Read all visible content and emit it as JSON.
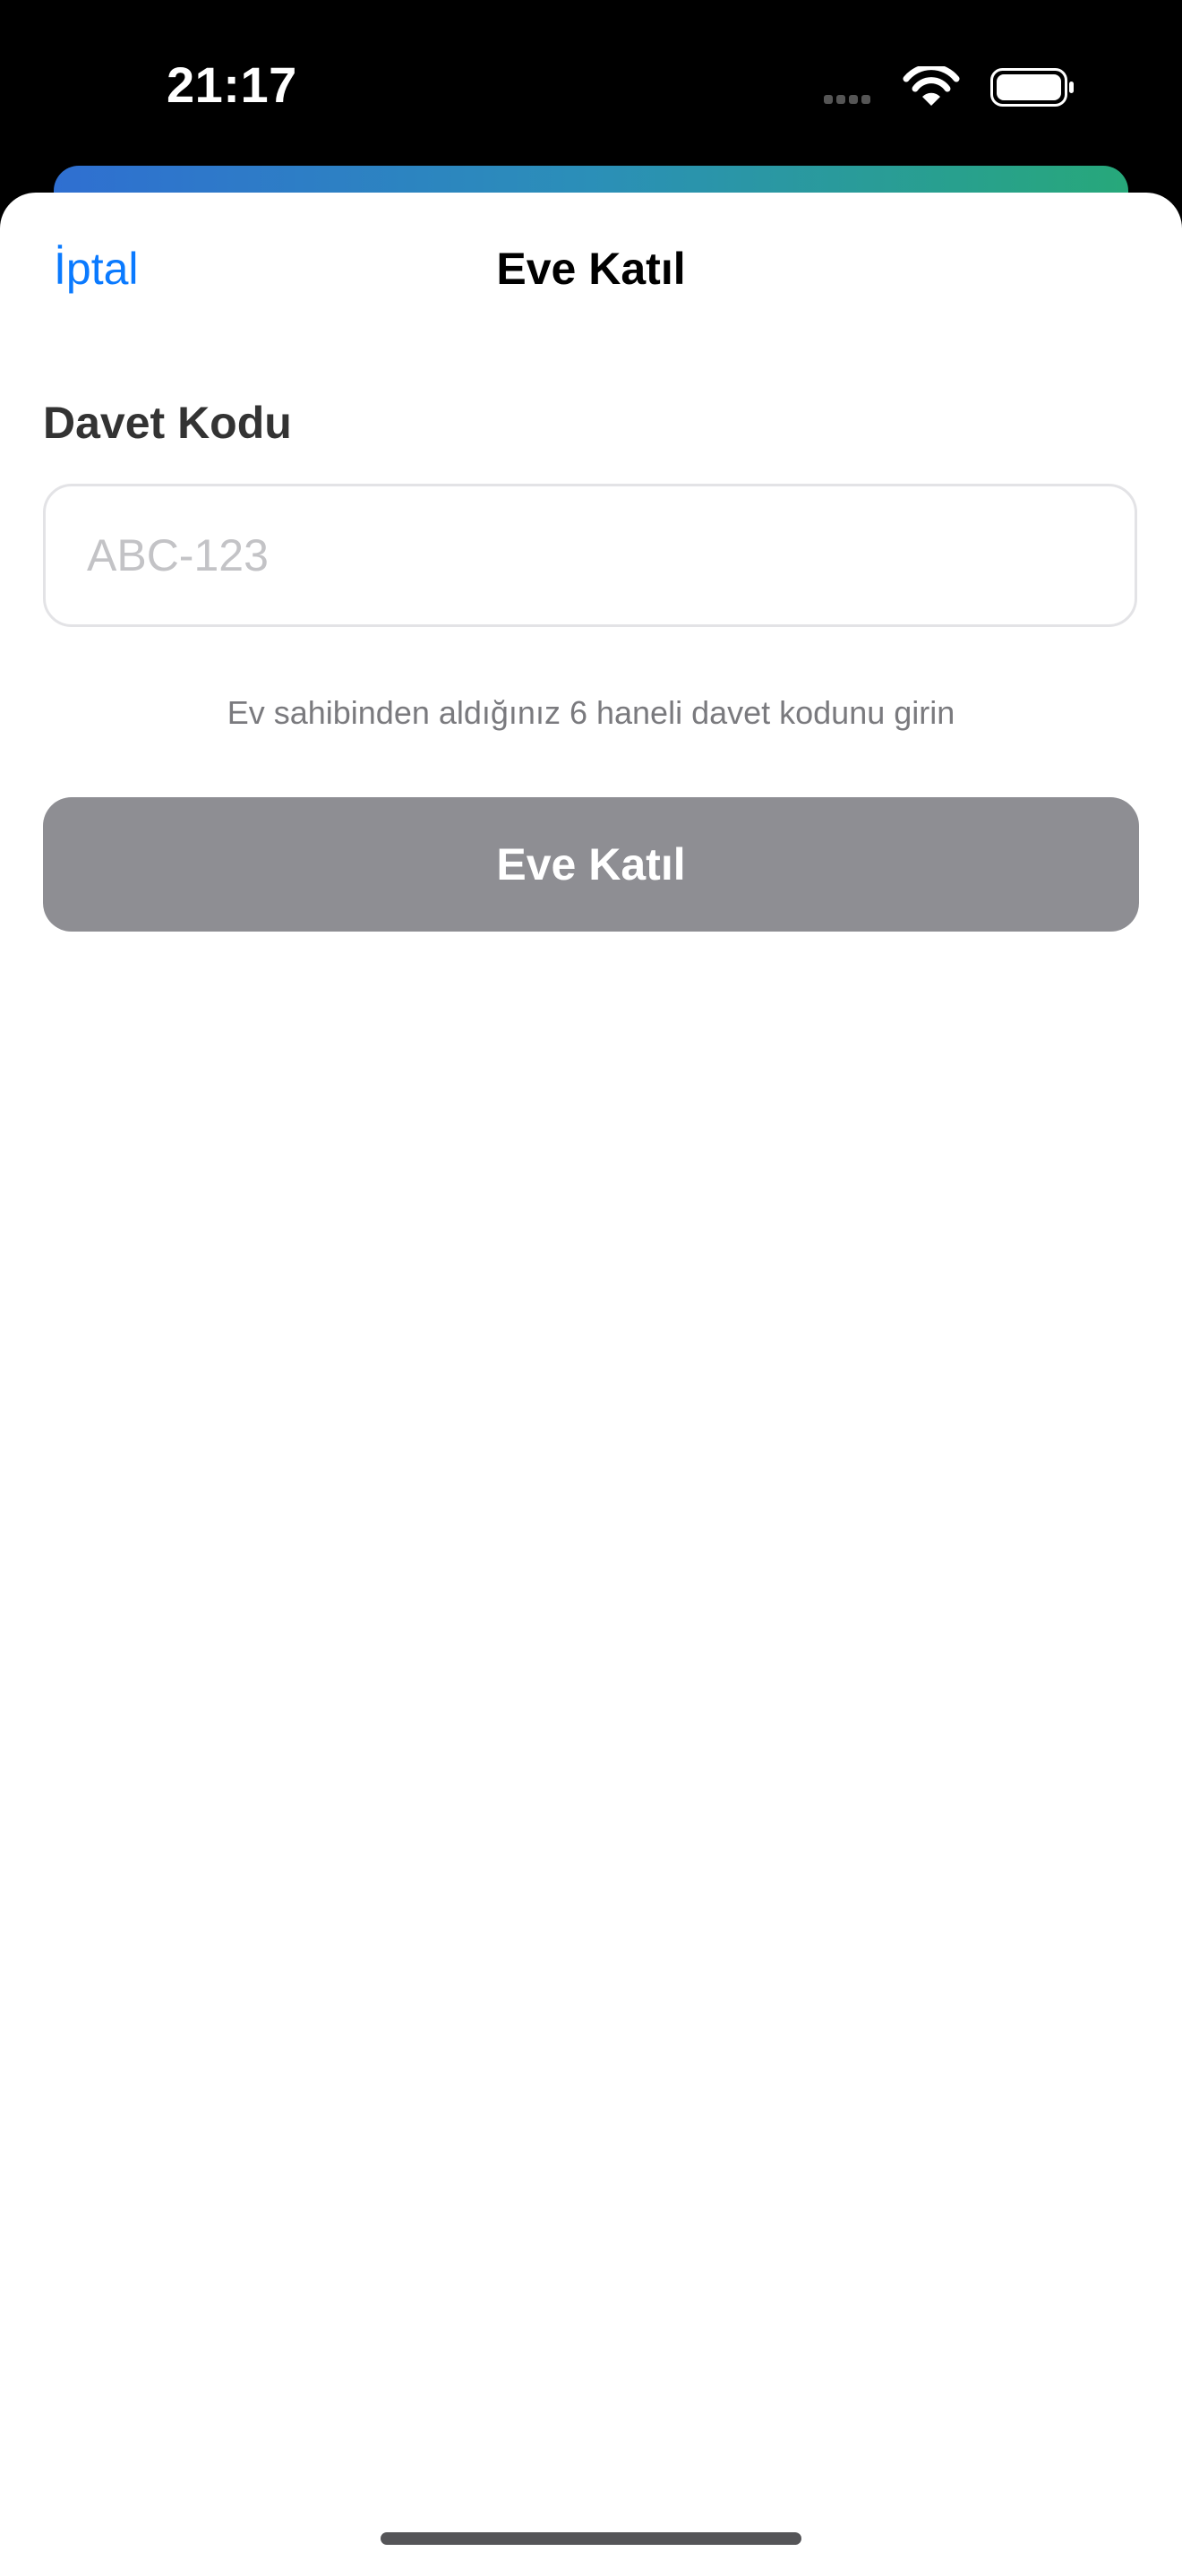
{
  "status_bar": {
    "time": "21:17",
    "icons": [
      "cellular-signal-icon",
      "wifi-icon",
      "battery-icon"
    ]
  },
  "sheet": {
    "cancel_label": "İptal",
    "title": "Eve Katıl"
  },
  "form": {
    "code_label": "Davet Kodu",
    "code_value": "",
    "code_placeholder": "ABC-123",
    "hint": "Ev sahibinden aldığınız 6 haneli davet kodunu girin",
    "submit_label": "Eve Katıl"
  },
  "colors": {
    "accent": "#0A7AFF",
    "button_disabled": "#8E8E93",
    "gradient_start": "#2F6FD1",
    "gradient_end": "#27A87A"
  }
}
